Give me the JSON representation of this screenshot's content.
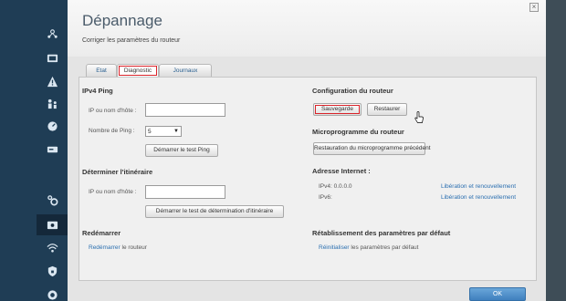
{
  "dialog": {
    "title": "Dépannage",
    "subtitle": "Corriger les paramètres du routeur",
    "close_label": "×"
  },
  "tabs": [
    {
      "label": "Etat"
    },
    {
      "label": "Diagnostic"
    },
    {
      "label": "Journaux"
    }
  ],
  "ping": {
    "heading": "IPv4 Ping",
    "host_label": "IP ou nom d'hôte :",
    "host_value": "",
    "count_label": "Nombre de Ping :",
    "count_value": "5",
    "start_button": "Démarrer le test Ping"
  },
  "traceroute": {
    "heading": "Déterminer l'itinéraire",
    "host_label": "IP ou nom d'hôte :",
    "host_value": "",
    "start_button": "Démarrer le test de détermination d'itinéraire"
  },
  "reboot": {
    "heading": "Redémarrer",
    "link": "Redémarrer",
    "text": " le routeur"
  },
  "config": {
    "heading": "Configuration du routeur",
    "backup_button": "Sauvegarde",
    "restore_button": "Restaurer"
  },
  "firmware": {
    "heading": "Microprogramme du routeur",
    "restore_button": "Restauration du microprogramme précédent"
  },
  "internet": {
    "heading": "Adresse Internet :",
    "ipv4_label": "IPv4: 0.0.0.0",
    "ipv6_label": "IPv6:",
    "ipv4_link": "Libération et renouvellement",
    "ipv6_link": "Libération et renouvellement"
  },
  "factory": {
    "heading": "Rétablissement des paramètres par défaut",
    "link": "Réinitialiser",
    "text": " les paramètres par défaut"
  },
  "footer": {
    "ok_label": "OK"
  },
  "sidebar": {
    "icons": [
      "network-map-icon",
      "devices-icon",
      "alert-icon",
      "parental-icon",
      "speed-icon",
      "storage-icon",
      "settings-icon",
      "troubleshooting-icon",
      "wifi-icon",
      "security-icon",
      "connectivity-icon"
    ]
  },
  "colors": {
    "sidebar": "#1f3d55",
    "accent_red": "#d9232a",
    "link": "#2b6fb0",
    "ok_button": "#4a8ac8"
  }
}
